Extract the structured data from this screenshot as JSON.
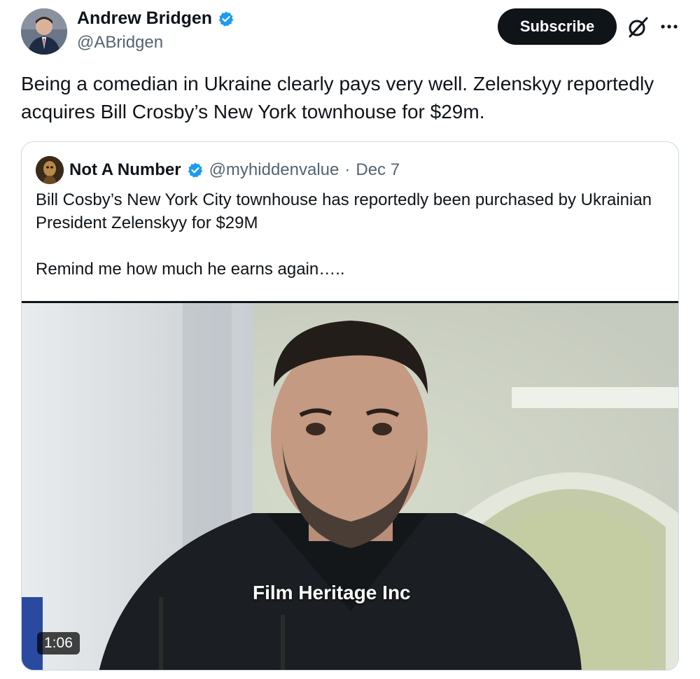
{
  "tweet": {
    "author": {
      "name": "Andrew Bridgen",
      "handle": "@ABridgen"
    },
    "subscribe_label": "Subscribe",
    "text": "Being a comedian in Ukraine clearly pays very well. Zelenskyy reportedly acquires Bill Crosby’s New York townhouse for $29m."
  },
  "quote": {
    "author": {
      "name": "Not A Number",
      "handle": "@myhiddenvalue",
      "separator": "·",
      "date": "Dec 7"
    },
    "text_lines": [
      "Bill Cosby’s New York City townhouse has reportedly been purchased by Ukrainian President Zelenskyy for $29M",
      "Remind me how much he earns again….."
    ],
    "media": {
      "watermark": "Film Heritage Inc",
      "duration": "1:06"
    }
  },
  "icons": {
    "verified": "verified-badge-icon",
    "grok": "grok-icon",
    "more": "more-options-icon"
  },
  "colors": {
    "verified_blue": "#1d9bf0",
    "text_primary": "#0f1419",
    "text_secondary": "#536471",
    "border": "#cfd9de"
  }
}
